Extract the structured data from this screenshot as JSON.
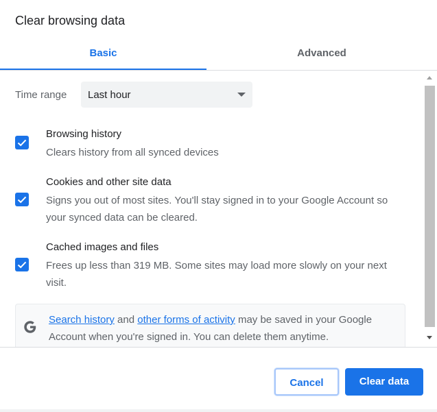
{
  "dialog": {
    "title": "Clear browsing data"
  },
  "tabs": [
    {
      "label": "Basic",
      "selected": true
    },
    {
      "label": "Advanced",
      "selected": false
    }
  ],
  "time_range": {
    "label": "Time range",
    "value": "Last hour"
  },
  "options": [
    {
      "title": "Browsing history",
      "description": "Clears history from all synced devices",
      "checked": true
    },
    {
      "title": "Cookies and other site data",
      "description": "Signs you out of most sites. You'll stay signed in to your Google Account so your synced data can be cleared.",
      "checked": true
    },
    {
      "title": "Cached images and files",
      "description": "Frees up less than 319 MB. Some sites may load more slowly on your next visit.",
      "checked": true
    }
  ],
  "info": {
    "link1": "Search history",
    "text1": " and ",
    "link2": "other forms of activity",
    "text2": " may be saved in your Google Account when you're signed in. You can delete them anytime."
  },
  "buttons": {
    "cancel": "Cancel",
    "clear": "Clear data"
  },
  "colors": {
    "accent": "#1a73e8",
    "text_primary": "#202124",
    "text_secondary": "#5f6368"
  },
  "icons": {
    "checkbox": "checkmark-icon",
    "dropdown": "caret-down-icon",
    "google": "google-g-icon"
  }
}
